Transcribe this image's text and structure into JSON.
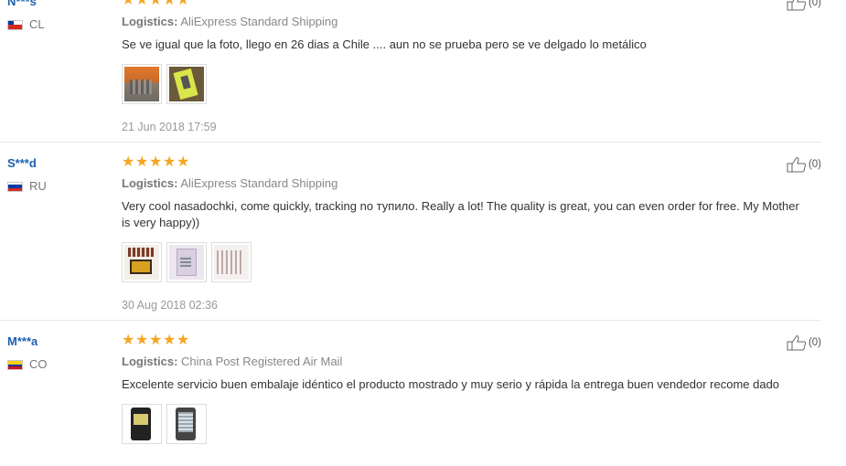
{
  "reviews": [
    {
      "user": "N***s",
      "country": "CL",
      "stars": [
        "★",
        "★",
        "★",
        "★",
        "★"
      ],
      "logistics_label": "Logistics:",
      "logistics_value": "AliExpress Standard Shipping",
      "text": "Se ve igual que la foto, llego en 26 dias a Chile .... aun no se prueba pero se ve delgado lo metálico",
      "date": "21 Jun 2018 17:59",
      "helpful": "(0)"
    },
    {
      "user": "S***d",
      "country": "RU",
      "stars": [
        "★",
        "★",
        "★",
        "★",
        "★"
      ],
      "logistics_label": "Logistics:",
      "logistics_value": "AliExpress Standard Shipping",
      "text": "Very cool nasadochki, come quickly, tracking no тупило. Really a lot! The quality is great, you can even order for free. My Mother is very happy))",
      "date": "30 Aug 2018 02:36",
      "helpful": "(0)"
    },
    {
      "user": "M***a",
      "country": "CO",
      "stars": [
        "★",
        "★",
        "★",
        "★",
        "★"
      ],
      "logistics_label": "Logistics:",
      "logistics_value": "China Post Registered Air Mail",
      "text": "Excelente servicio buen embalaje idéntico el producto mostrado y muy serio y rápida la entrega buen vendedor recome dado",
      "date": "",
      "helpful": "(0)"
    }
  ],
  "icons": {
    "like": "thumbs-up-icon",
    "star": "star-icon"
  },
  "colors": {
    "star": "#f5a623",
    "username": "#1c5fb0",
    "muted": "#999999"
  }
}
